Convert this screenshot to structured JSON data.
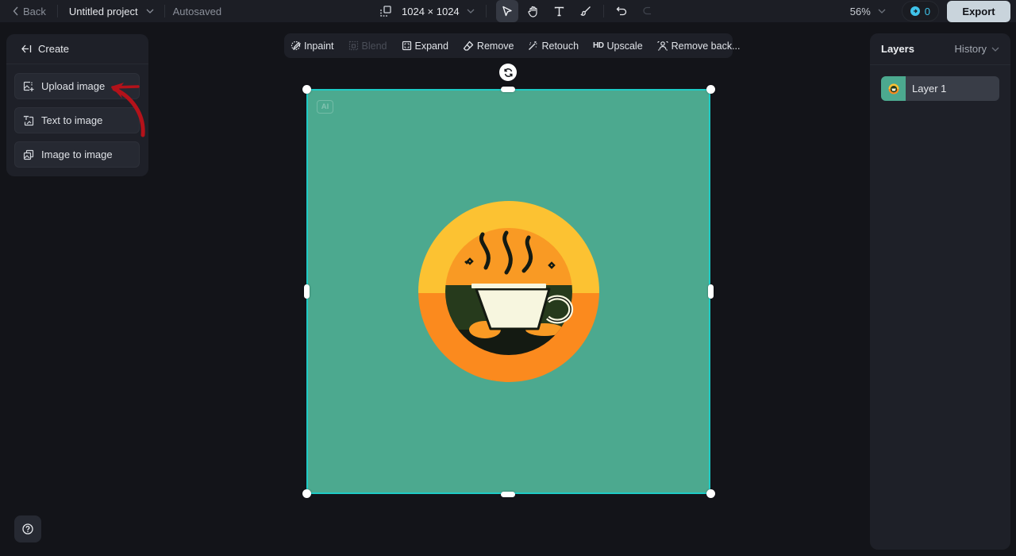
{
  "topbar": {
    "back_label": "Back",
    "project_name": "Untitled project",
    "save_status": "Autosaved",
    "canvas_size": "1024 × 1024",
    "zoom_level": "56%",
    "credits": "0",
    "export_label": "Export",
    "tools": [
      {
        "name": "select",
        "icon": "cursor-icon",
        "active": true
      },
      {
        "name": "hand",
        "icon": "hand-icon",
        "active": false
      },
      {
        "name": "text",
        "icon": "text-icon",
        "active": false
      },
      {
        "name": "brush",
        "icon": "brush-icon",
        "active": false
      }
    ]
  },
  "create_panel": {
    "title": "Create",
    "items": [
      {
        "label": "Upload image",
        "icon": "upload-image-icon"
      },
      {
        "label": "Text to image",
        "icon": "text-to-image-icon"
      },
      {
        "label": "Image to image",
        "icon": "image-to-image-icon"
      }
    ]
  },
  "ai_toolbar": {
    "tools": [
      {
        "label": "Inpaint",
        "enabled": true
      },
      {
        "label": "Blend",
        "enabled": false
      },
      {
        "label": "Expand",
        "enabled": true
      },
      {
        "label": "Remove",
        "enabled": true
      },
      {
        "label": "Retouch",
        "enabled": true
      },
      {
        "label": "Upscale",
        "prefix": "HD",
        "enabled": true
      },
      {
        "label": "Remove back...",
        "enabled": true
      }
    ]
  },
  "canvas": {
    "badge": "AI",
    "background_color": "#4ca98f",
    "selection_color": "#1ecbc6",
    "image_description": "Coffee cup logo in circular emblem"
  },
  "layers_panel": {
    "title": "Layers",
    "history_label": "History",
    "layers": [
      {
        "name": "Layer 1"
      }
    ]
  },
  "colors": {
    "accent": "#1ecbc6",
    "credits": "#3fc3ea",
    "annotation_arrow": "#b3121a"
  }
}
